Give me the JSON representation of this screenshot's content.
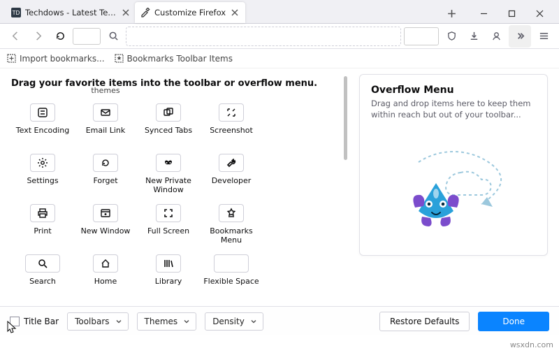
{
  "tabs": {
    "tab1": "Techdows - Latest Technology N",
    "tab2": "Customize Firefox"
  },
  "bookmarks_bar": {
    "import": "Import bookmarks...",
    "items": "Bookmarks Toolbar Items"
  },
  "customize": {
    "heading": "Drag your favorite items into the toolbar or overflow menu.",
    "truncated_top": "themes",
    "items": [
      {
        "key": "text-encoding",
        "label": "Text Encoding"
      },
      {
        "key": "email-link",
        "label": "Email Link"
      },
      {
        "key": "synced-tabs",
        "label": "Synced Tabs"
      },
      {
        "key": "screenshot",
        "label": "Screenshot"
      },
      {
        "key": "settings",
        "label": "Settings"
      },
      {
        "key": "forget",
        "label": "Forget"
      },
      {
        "key": "new-private-window",
        "label": "New Private Window"
      },
      {
        "key": "developer",
        "label": "Developer"
      },
      {
        "key": "print",
        "label": "Print"
      },
      {
        "key": "new-window",
        "label": "New Window"
      },
      {
        "key": "full-screen",
        "label": "Full Screen"
      },
      {
        "key": "bookmarks-menu",
        "label": "Bookmarks Menu"
      },
      {
        "key": "search",
        "label": "Search"
      },
      {
        "key": "home",
        "label": "Home"
      },
      {
        "key": "library",
        "label": "Library"
      },
      {
        "key": "flexible-space",
        "label": "Flexible Space"
      }
    ]
  },
  "overflow": {
    "title": "Overflow Menu",
    "desc": "Drag and drop items here to keep them within reach but out of your toolbar..."
  },
  "footer": {
    "title_bar": "Title Bar",
    "toolbars": "Toolbars",
    "themes": "Themes",
    "density": "Density",
    "restore": "Restore Defaults",
    "done": "Done"
  },
  "watermark": "wsxdn.com"
}
